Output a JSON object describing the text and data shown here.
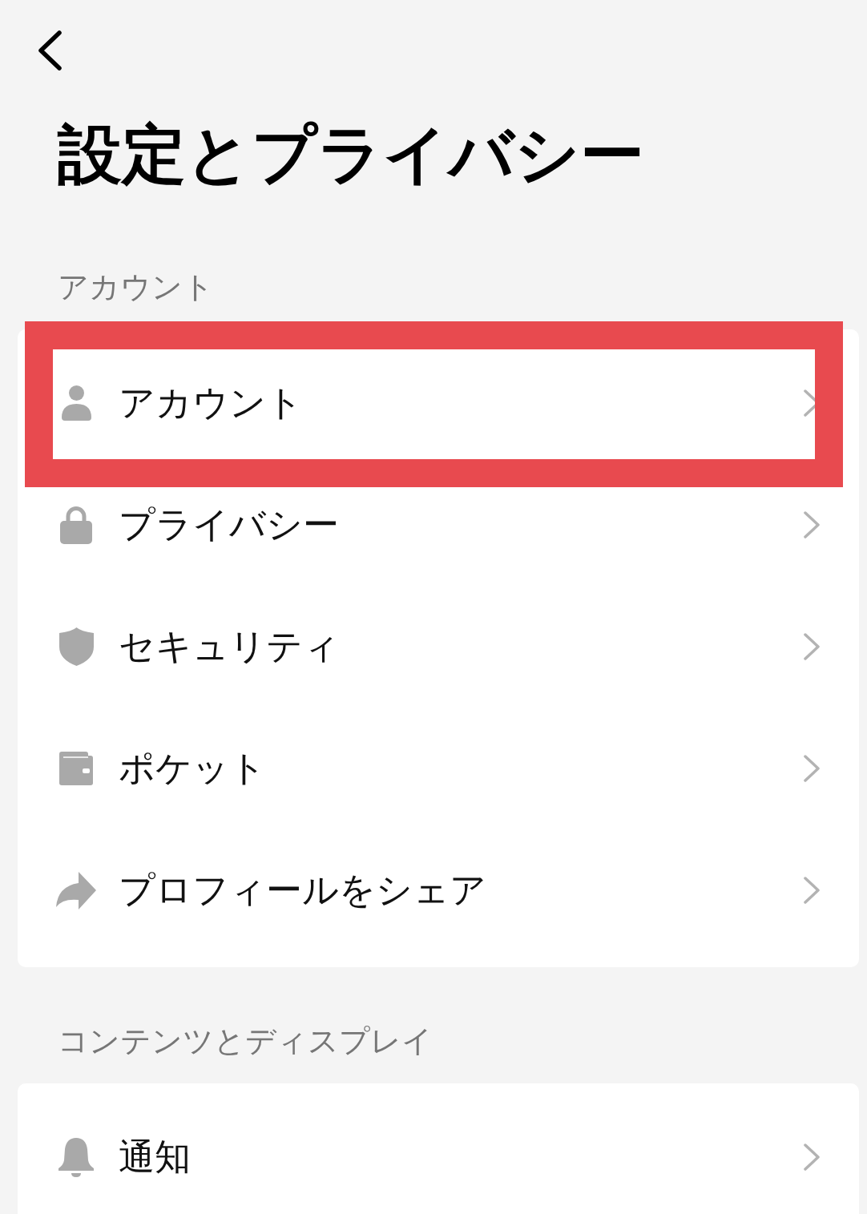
{
  "header": {
    "title": "設定とプライバシー"
  },
  "sections": [
    {
      "title": "アカウント",
      "items": [
        {
          "label": "アカウント",
          "highlighted": true
        },
        {
          "label": "プライバシー",
          "highlighted": false
        },
        {
          "label": "セキュリティ",
          "highlighted": false
        },
        {
          "label": "ポケット",
          "highlighted": false
        },
        {
          "label": "プロフィールをシェア",
          "highlighted": false
        }
      ]
    },
    {
      "title": "コンテンツとディスプレイ",
      "items": [
        {
          "label": "通知",
          "highlighted": false
        }
      ]
    }
  ]
}
